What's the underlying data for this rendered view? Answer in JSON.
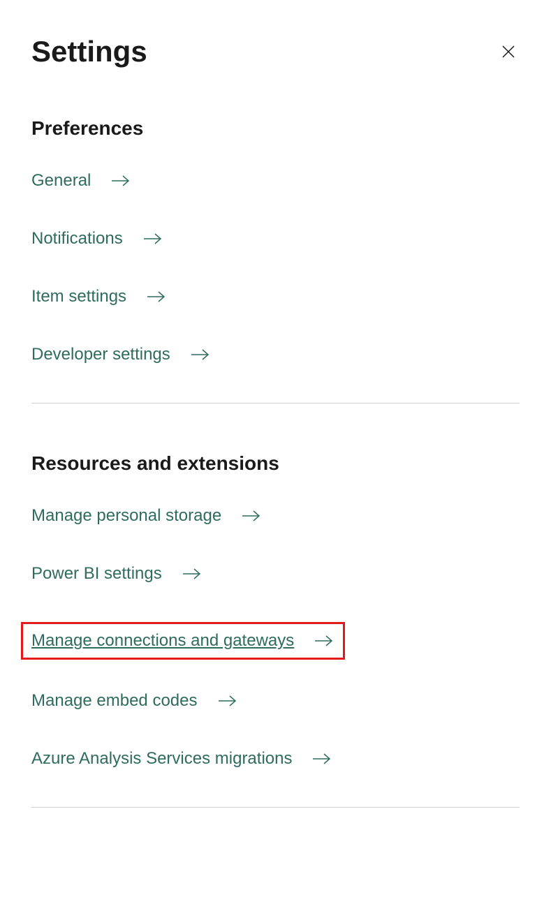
{
  "header": {
    "title": "Settings"
  },
  "sections": {
    "preferences": {
      "title": "Preferences",
      "items": [
        {
          "label": "General"
        },
        {
          "label": "Notifications"
        },
        {
          "label": "Item settings"
        },
        {
          "label": "Developer settings"
        }
      ]
    },
    "resources": {
      "title": "Resources and extensions",
      "items": [
        {
          "label": "Manage personal storage"
        },
        {
          "label": "Power BI settings"
        },
        {
          "label": "Manage connections and gateways"
        },
        {
          "label": "Manage embed codes"
        },
        {
          "label": "Azure Analysis Services migrations"
        }
      ]
    }
  }
}
